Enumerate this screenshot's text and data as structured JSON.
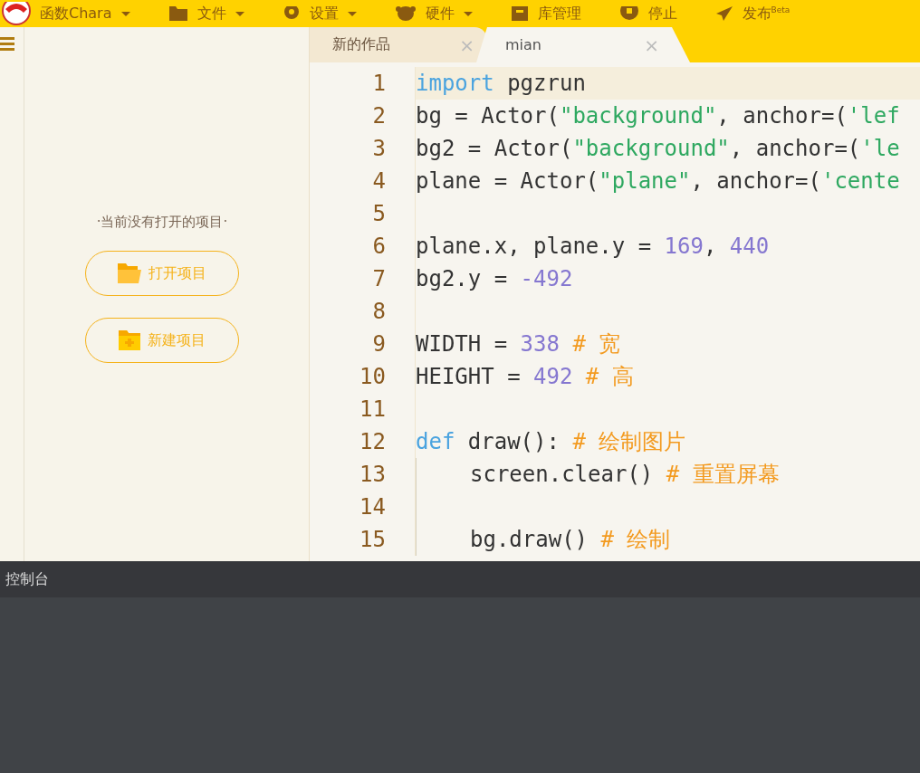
{
  "menu_bar": {
    "items": [
      {
        "kind": "logo",
        "label": "函数Chara",
        "caret": true
      },
      {
        "kind": "folder",
        "label": "文件",
        "caret": true
      },
      {
        "kind": "gear",
        "label": "设置",
        "caret": true
      },
      {
        "kind": "hardware",
        "label": "硬件",
        "caret": true
      },
      {
        "kind": "box",
        "label": "库管理",
        "caret": false
      },
      {
        "kind": "stop",
        "label": "停止",
        "caret": false
      },
      {
        "kind": "send",
        "label": "发布$^{Beta}$",
        "caret": false
      }
    ]
  },
  "sidebar": {
    "empty_message": "·当前没有打开的项目·",
    "buttons": [
      {
        "kind": "open",
        "label": "打开项目"
      },
      {
        "kind": "new",
        "label": "新建项目"
      }
    ]
  },
  "tabs": [
    {
      "label": "新的作品",
      "selected": false,
      "close": "×"
    },
    {
      "label": "mian",
      "selected": true,
      "close": "×"
    }
  ],
  "editor": {
    "lines": [
      {
        "number": "1",
        "current": true,
        "indent": false,
        "tokens": [
          {
            "kind": "keyword",
            "text": "import"
          },
          {
            "kind": "plain",
            "text": " pgzrun"
          }
        ]
      },
      {
        "number": "2",
        "current": false,
        "indent": false,
        "tokens": [
          {
            "kind": "plain",
            "text": "bg = Actor("
          },
          {
            "kind": "string",
            "text": "\"background\""
          },
          {
            "kind": "plain",
            "text": ", anchor=("
          },
          {
            "kind": "string",
            "text": "'lef"
          }
        ]
      },
      {
        "number": "3",
        "current": false,
        "indent": false,
        "tokens": [
          {
            "kind": "plain",
            "text": "bg2 = Actor("
          },
          {
            "kind": "string",
            "text": "\"background\""
          },
          {
            "kind": "plain",
            "text": ", anchor=("
          },
          {
            "kind": "string",
            "text": "'le"
          }
        ]
      },
      {
        "number": "4",
        "current": false,
        "indent": false,
        "tokens": [
          {
            "kind": "plain",
            "text": "plane = Actor("
          },
          {
            "kind": "string",
            "text": "\"plane\""
          },
          {
            "kind": "plain",
            "text": ", anchor=("
          },
          {
            "kind": "string",
            "text": "'cente"
          }
        ]
      },
      {
        "number": "5",
        "current": false,
        "indent": false
      },
      {
        "number": "6",
        "current": false,
        "indent": false,
        "tokens": [
          {
            "kind": "plain",
            "text": "plane.x, plane.y = "
          },
          {
            "kind": "number",
            "text": "169"
          },
          {
            "kind": "plain",
            "text": ", "
          },
          {
            "kind": "number",
            "text": "440"
          }
        ]
      },
      {
        "number": "7",
        "current": false,
        "indent": false,
        "tokens": [
          {
            "kind": "plain",
            "text": "bg2.y = "
          },
          {
            "kind": "number",
            "text": "-492"
          }
        ]
      },
      {
        "number": "8",
        "current": false,
        "indent": false
      },
      {
        "number": "9",
        "current": false,
        "indent": false,
        "tokens": [
          {
            "kind": "plain",
            "text": "WIDTH = "
          },
          {
            "kind": "number",
            "text": "338"
          },
          {
            "kind": "comment",
            "text": " # 宽"
          }
        ]
      },
      {
        "number": "10",
        "current": false,
        "indent": false,
        "tokens": [
          {
            "kind": "plain",
            "text": "HEIGHT = "
          },
          {
            "kind": "number",
            "text": "492"
          },
          {
            "kind": "comment",
            "text": " # 高"
          }
        ]
      },
      {
        "number": "11",
        "current": false,
        "indent": false
      },
      {
        "number": "12",
        "current": false,
        "indent": false,
        "tokens": [
          {
            "kind": "keyword",
            "text": "def"
          },
          {
            "kind": "plain",
            "text": " draw():"
          },
          {
            "kind": "comment",
            "text": " # 绘制图片"
          }
        ]
      },
      {
        "number": "13",
        "current": false,
        "indent": true,
        "tokens": [
          {
            "kind": "plain",
            "text": "screen.clear()"
          },
          {
            "kind": "comment",
            "text": " # 重置屏幕"
          }
        ]
      },
      {
        "number": "14",
        "current": false,
        "indent": true
      },
      {
        "number": "15",
        "current": false,
        "indent": true,
        "tokens": [
          {
            "kind": "plain",
            "text": "bg.draw()"
          },
          {
            "kind": "comment",
            "text": " # 绘制"
          }
        ]
      }
    ]
  },
  "console": {
    "title": "控制台"
  }
}
